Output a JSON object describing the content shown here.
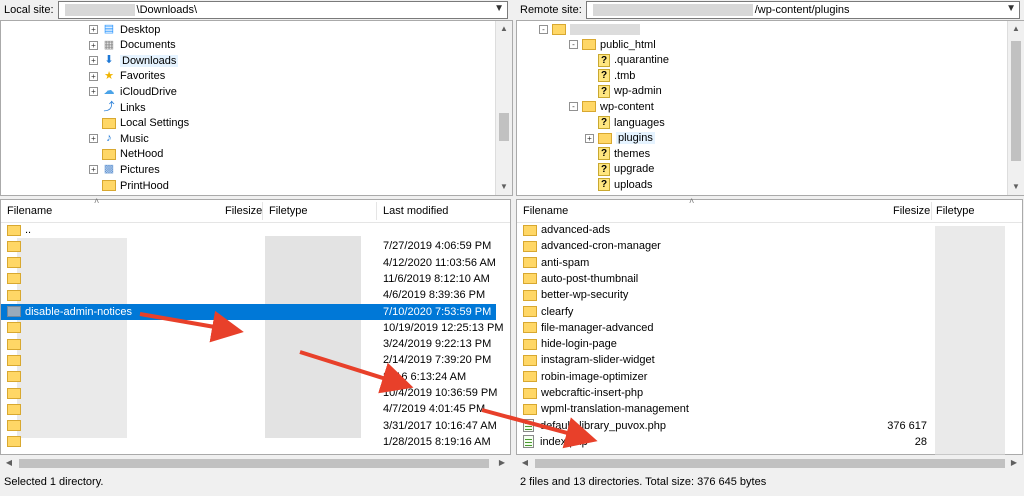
{
  "local": {
    "site_label": "Local site:",
    "path_suffix": "\\Downloads\\",
    "tree": [
      {
        "label": "Desktop",
        "icon": "desktop-icon"
      },
      {
        "label": "Documents",
        "icon": "documents-icon"
      },
      {
        "label": "Downloads",
        "icon": "download-arrow-icon"
      },
      {
        "label": "Favorites",
        "icon": "star-icon"
      },
      {
        "label": "iCloudDrive",
        "icon": "cloud-icon"
      },
      {
        "label": "Links",
        "icon": "link-arrow-icon"
      },
      {
        "label": "Local Settings",
        "icon": "folder-icon"
      },
      {
        "label": "Music",
        "icon": "music-note-icon"
      },
      {
        "label": "NetHood",
        "icon": "folder-icon"
      },
      {
        "label": "Pictures",
        "icon": "pictures-icon"
      },
      {
        "label": "PrintHood",
        "icon": "folder-icon"
      }
    ],
    "columns": {
      "filename": "Filename",
      "filesize": "Filesize",
      "filetype": "Filetype",
      "modified": "Last modified"
    },
    "files": [
      {
        "name": "..",
        "modified": ""
      },
      {
        "name": "",
        "modified": "7/27/2019 4:06:59 PM"
      },
      {
        "name": "",
        "modified": "4/12/2020 11:03:56 AM"
      },
      {
        "name": "",
        "modified": "11/6/2019 8:12:10 AM"
      },
      {
        "name": "",
        "modified": "4/6/2019 8:39:36 PM"
      },
      {
        "name": "disable-admin-notices",
        "modified": "7/10/2020 7:53:59 PM",
        "selected": true
      },
      {
        "name": "",
        "modified": "10/19/2019 12:25:13 PM"
      },
      {
        "name": "",
        "modified": "3/24/2019 9:22:13 PM"
      },
      {
        "name": "",
        "modified": "2/14/2019 7:39:20 PM"
      },
      {
        "name": "",
        "modified": "2016 6:13:24 AM"
      },
      {
        "name": "",
        "modified": "10/4/2019 10:36:59 PM"
      },
      {
        "name": "",
        "modified": "4/7/2019 4:01:45 PM"
      },
      {
        "name": "",
        "modified": "3/31/2017 10:16:47 AM"
      },
      {
        "name": "",
        "modified": "1/28/2015 8:19:16 AM"
      }
    ],
    "status": "Selected 1 directory."
  },
  "remote": {
    "site_label": "Remote site:",
    "path_suffix": "/wp-content/plugins",
    "tree": [
      {
        "label": "public_html",
        "icon": "folder-icon",
        "exp": "-"
      },
      {
        "label": ".quarantine",
        "icon": "question-folder-icon"
      },
      {
        "label": ".tmb",
        "icon": "question-folder-icon"
      },
      {
        "label": "wp-admin",
        "icon": "question-folder-icon"
      },
      {
        "label": "wp-content",
        "icon": "folder-icon",
        "exp": "-"
      },
      {
        "label": "languages",
        "icon": "question-folder-icon"
      },
      {
        "label": "plugins",
        "icon": "folder-icon",
        "exp": "+",
        "selected": true
      },
      {
        "label": "themes",
        "icon": "question-folder-icon"
      },
      {
        "label": "upgrade",
        "icon": "question-folder-icon"
      },
      {
        "label": "uploads",
        "icon": "question-folder-icon"
      }
    ],
    "columns": {
      "filename": "Filename",
      "filesize": "Filesize",
      "filetype": "Filetype"
    },
    "files": [
      {
        "name": "advanced-ads",
        "size": "",
        "kind": "folder"
      },
      {
        "name": "advanced-cron-manager",
        "size": "",
        "kind": "folder"
      },
      {
        "name": "anti-spam",
        "size": "",
        "kind": "folder"
      },
      {
        "name": "auto-post-thumbnail",
        "size": "",
        "kind": "folder"
      },
      {
        "name": "better-wp-security",
        "size": "",
        "kind": "folder"
      },
      {
        "name": "clearfy",
        "size": "",
        "kind": "folder"
      },
      {
        "name": "file-manager-advanced",
        "size": "",
        "kind": "folder"
      },
      {
        "name": "hide-login-page",
        "size": "",
        "kind": "folder"
      },
      {
        "name": "instagram-slider-widget",
        "size": "",
        "kind": "folder"
      },
      {
        "name": "robin-image-optimizer",
        "size": "",
        "kind": "folder"
      },
      {
        "name": "webcraftic-insert-php",
        "size": "",
        "kind": "folder"
      },
      {
        "name": "wpml-translation-management",
        "size": "",
        "kind": "folder"
      },
      {
        "name": "default_library_puvox.php",
        "size": "376 617",
        "kind": "file"
      },
      {
        "name": "index.php",
        "size": "28",
        "kind": "file"
      }
    ],
    "status": "2 files and 13 directories. Total size: 376 645 bytes"
  },
  "colors": {
    "selection": "#0078d7",
    "arrow": "#e8402a",
    "folder": "#ffd766"
  }
}
